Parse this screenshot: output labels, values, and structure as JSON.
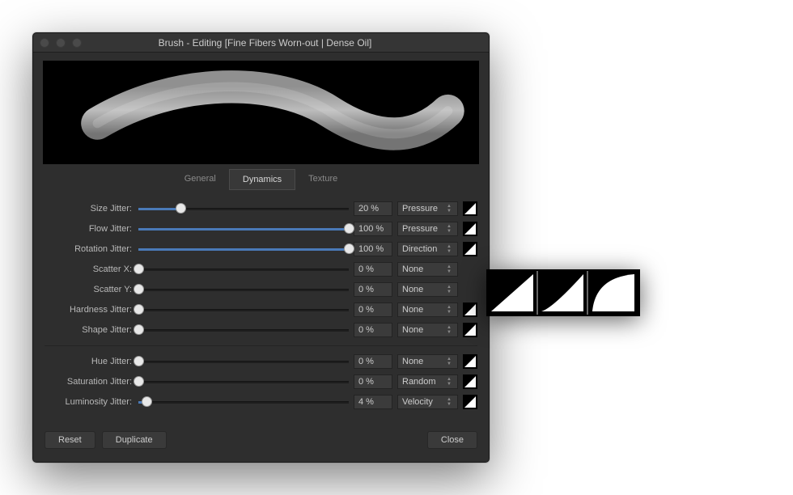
{
  "title": "Brush - Editing [Fine Fibers Worn-out | Dense Oil]",
  "tabs": {
    "general": "General",
    "dynamics": "Dynamics",
    "texture": "Texture"
  },
  "rows": {
    "size": {
      "label": "Size Jitter:",
      "value": "20 %",
      "pct": 20,
      "mode": "Pressure",
      "curve": true
    },
    "flow": {
      "label": "Flow Jitter:",
      "value": "100 %",
      "pct": 100,
      "mode": "Pressure",
      "curve": true
    },
    "rotation": {
      "label": "Rotation Jitter:",
      "value": "100 %",
      "pct": 100,
      "mode": "Direction",
      "curve": true
    },
    "scatterx": {
      "label": "Scatter X:",
      "value": "0 %",
      "pct": 0,
      "mode": "None",
      "curve": false
    },
    "scattery": {
      "label": "Scatter Y:",
      "value": "0 %",
      "pct": 0,
      "mode": "None",
      "curve": false
    },
    "hardness": {
      "label": "Hardness Jitter:",
      "value": "0 %",
      "pct": 0,
      "mode": "None",
      "curve": true
    },
    "shape": {
      "label": "Shape Jitter:",
      "value": "0 %",
      "pct": 0,
      "mode": "None",
      "curve": true
    },
    "hue": {
      "label": "Hue Jitter:",
      "value": "0 %",
      "pct": 0,
      "mode": "None",
      "curve": true
    },
    "saturation": {
      "label": "Saturation Jitter:",
      "value": "0 %",
      "pct": 0,
      "mode": "Random",
      "curve": true
    },
    "luminosity": {
      "label": "Luminosity Jitter:",
      "value": "4 %",
      "pct": 4,
      "mode": "Velocity",
      "curve": true
    }
  },
  "buttons": {
    "reset": "Reset",
    "duplicate": "Duplicate",
    "close": "Close"
  },
  "popout_curves": [
    "linear",
    "ease-in",
    "ease-out"
  ]
}
